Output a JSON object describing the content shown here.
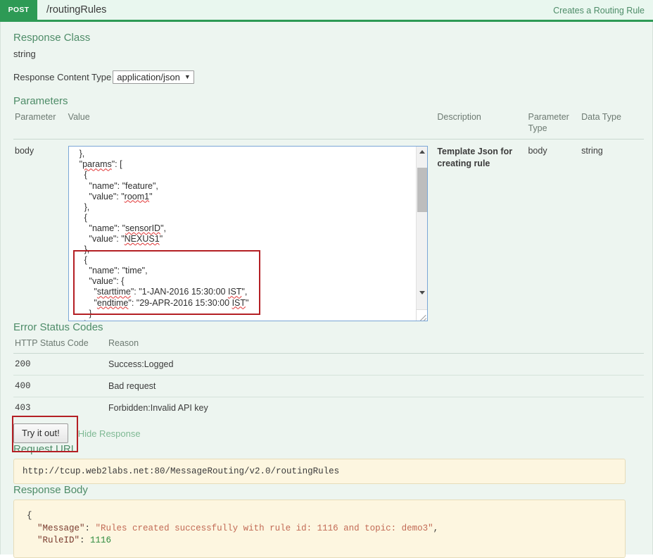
{
  "operation": {
    "method": "POST",
    "path": "/routingRules",
    "summary": "Creates a Routing Rule"
  },
  "response_class": {
    "heading": "Response Class",
    "model": "string",
    "content_type_label": "Response Content Type",
    "content_type_value": "application/json",
    "caret_icon": "chevron-down-icon"
  },
  "parameters": {
    "heading": "Parameters",
    "columns": [
      "Parameter",
      "Value",
      "Description",
      "Parameter Type",
      "Data Type"
    ],
    "rows": [
      {
        "parameter": "body",
        "description": "Template Json for creating rule",
        "parameter_type": "body",
        "data_type": "string"
      }
    ],
    "body_value_lines": [
      "  },",
      "  \"params\": [",
      "    {",
      "      \"name\": \"feature\",",
      "      \"value\": \"room1\"",
      "    },",
      "    {",
      "      \"name\": \"sensorID\",",
      "      \"value\": \"NEXUS1\"",
      "    },",
      "    {",
      "      \"name\": \"time\",",
      "      \"value\": {",
      "        \"starttime\": \"1-JAN-2016 15:30:00 IST\",",
      "        \"endtime\": \"29-APR-2016 15:30:00 IST\"",
      "      }",
      "    },"
    ],
    "spellcheck_words": [
      "params",
      "room1",
      "sensorID",
      "NEXUS1",
      "starttime",
      "endtime",
      "IST"
    ]
  },
  "error_status_codes": {
    "heading": "Error Status Codes",
    "columns": [
      "HTTP Status Code",
      "Reason"
    ],
    "rows": [
      {
        "code": "200",
        "reason": "Success:Logged"
      },
      {
        "code": "400",
        "reason": "Bad request"
      },
      {
        "code": "403",
        "reason": "Forbidden:Invalid API key"
      }
    ]
  },
  "actions": {
    "try_it_out": "Try it out!",
    "hide_response": "Hide Response"
  },
  "request_url": {
    "heading": "Request URL",
    "url": "http://tcup.web2labs.net:80/MessageRouting/v2.0/routingRules"
  },
  "response_body": {
    "heading": "Response Body",
    "open_brace": "{",
    "message_key": "\"Message\"",
    "message_value": "\"Rules created successfully with rule id: 1116 and topic: demo3\"",
    "ruleid_key": "\"RuleID\"",
    "ruleid_value": "1116",
    "colon": ": ",
    "comma": ","
  },
  "annotations": [
    {
      "name": "time-param-highlight"
    },
    {
      "name": "try-it-out-highlight"
    }
  ],
  "colors": {
    "method_green": "#2d9a55",
    "panel_background": "#edf5f0",
    "section_heading": "#4e8c68",
    "annotation_red": "#b41f24",
    "code_background": "#fdf6e0"
  }
}
